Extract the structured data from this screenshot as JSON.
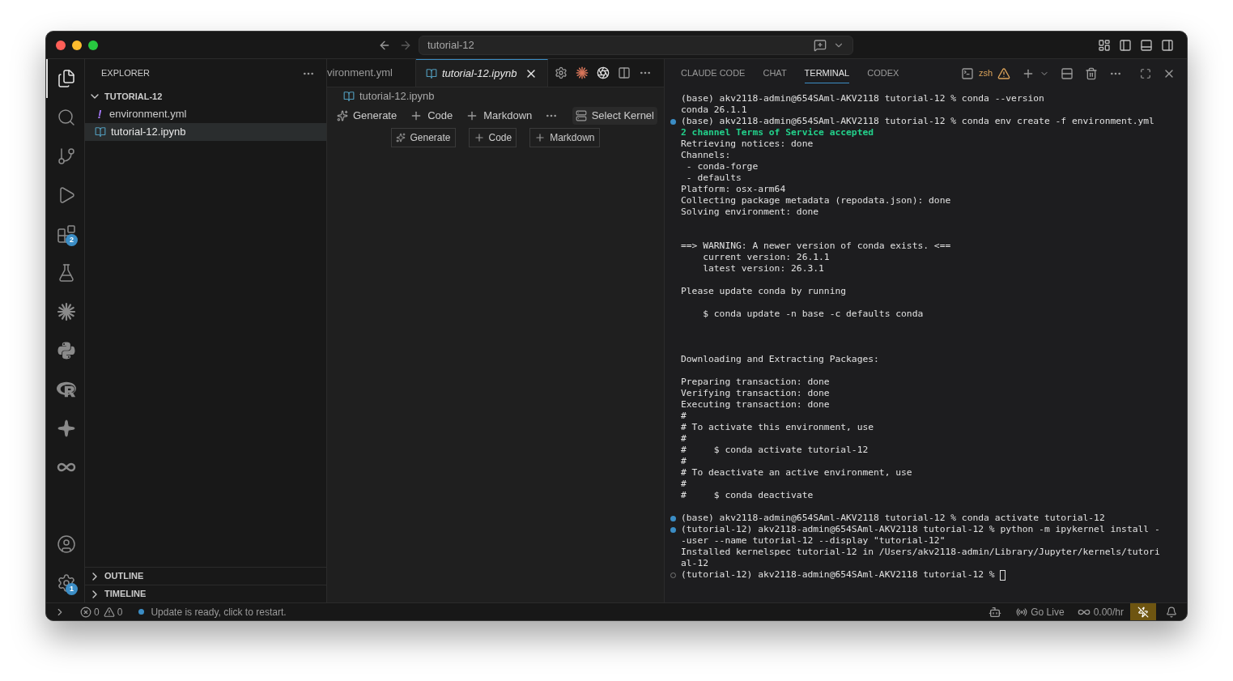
{
  "window": {
    "command_center": "tutorial-12"
  },
  "activity_bar": {
    "items": [
      {
        "kind": "explorer",
        "selected": true
      },
      {
        "kind": "search",
        "selected": false
      },
      {
        "kind": "source-control",
        "selected": false
      },
      {
        "kind": "run",
        "selected": false
      },
      {
        "kind": "extensions",
        "selected": false,
        "badge": "2"
      },
      {
        "kind": "testing",
        "selected": false
      },
      {
        "kind": "claude",
        "selected": false
      },
      {
        "kind": "python",
        "selected": false
      },
      {
        "kind": "r",
        "selected": false
      },
      {
        "kind": "sparkle",
        "selected": false
      },
      {
        "kind": "loop",
        "selected": false
      }
    ],
    "bottom": [
      {
        "kind": "account"
      },
      {
        "kind": "settings",
        "badge": "1"
      }
    ]
  },
  "sidebar": {
    "title": "EXPLORER",
    "folder": {
      "name": "TUTORIAL-12",
      "expanded": true,
      "files": [
        {
          "name": "environment.yml",
          "kind": "yaml",
          "glyph": "!",
          "selected": false
        },
        {
          "name": "tutorial-12.ipynb",
          "kind": "notebook",
          "selected": true
        }
      ]
    },
    "sections": [
      {
        "label": "OUTLINE",
        "expanded": false
      },
      {
        "label": "TIMELINE",
        "expanded": false
      }
    ]
  },
  "editor": {
    "tabs": [
      {
        "label": "vironment.yml",
        "selected": false
      },
      {
        "label": "tutorial-12.ipynb",
        "selected": true
      }
    ],
    "breadcrumb": "tutorial-12.ipynb",
    "toolbar": [
      "Generate",
      "Code",
      "Markdown"
    ],
    "kernel": "Select Kernel",
    "cell_buttons": [
      "Generate",
      "Code",
      "Markdown"
    ]
  },
  "panel": {
    "tabs": [
      {
        "label": "CLAUDE CODE",
        "selected": false
      },
      {
        "label": "CHAT",
        "selected": false
      },
      {
        "label": "TERMINAL",
        "selected": true
      },
      {
        "label": "CODEX",
        "selected": false
      }
    ],
    "shell": "zsh",
    "lines": [
      {
        "kind": "output",
        "text": "(base) akv2118-admin@654SAml-AKV2118 tutorial-12 % conda --version"
      },
      {
        "kind": "output",
        "text": "conda 26.1.1"
      },
      {
        "kind": "output",
        "command": true,
        "succeeded": true,
        "text": "(base) akv2118-admin@654SAml-AKV2118 tutorial-12 % conda env create -f environment.yml"
      },
      {
        "kind": "success",
        "text": "2 channel Terms of Service accepted"
      },
      {
        "kind": "output",
        "text": "Retrieving notices: done"
      },
      {
        "kind": "output",
        "text": "Channels:"
      },
      {
        "kind": "output",
        "text": " - conda-forge"
      },
      {
        "kind": "output",
        "text": " - defaults"
      },
      {
        "kind": "output",
        "text": "Platform: osx-arm64"
      },
      {
        "kind": "output",
        "text": "Collecting package metadata (repodata.json): done"
      },
      {
        "kind": "output",
        "text": "Solving environment: done"
      },
      {
        "kind": "blank"
      },
      {
        "kind": "blank"
      },
      {
        "kind": "output",
        "text": "==> WARNING: A newer version of conda exists. <=="
      },
      {
        "kind": "output",
        "text": "    current version: 26.1.1"
      },
      {
        "kind": "output",
        "text": "    latest version: 26.3.1"
      },
      {
        "kind": "blank"
      },
      {
        "kind": "output",
        "text": "Please update conda by running"
      },
      {
        "kind": "blank"
      },
      {
        "kind": "output",
        "text": "    $ conda update -n base -c defaults conda"
      },
      {
        "kind": "blank"
      },
      {
        "kind": "blank"
      },
      {
        "kind": "blank"
      },
      {
        "kind": "output",
        "text": "Downloading and Extracting Packages:"
      },
      {
        "kind": "blank"
      },
      {
        "kind": "output",
        "text": "Preparing transaction: done"
      },
      {
        "kind": "output",
        "text": "Verifying transaction: done"
      },
      {
        "kind": "output",
        "text": "Executing transaction: done"
      },
      {
        "kind": "output",
        "text": "#"
      },
      {
        "kind": "output",
        "text": "# To activate this environment, use"
      },
      {
        "kind": "output",
        "text": "#"
      },
      {
        "kind": "output",
        "text": "#     $ conda activate tutorial-12"
      },
      {
        "kind": "output",
        "text": "#"
      },
      {
        "kind": "output",
        "text": "# To deactivate an active environment, use"
      },
      {
        "kind": "output",
        "text": "#"
      },
      {
        "kind": "output",
        "text": "#     $ conda deactivate"
      },
      {
        "kind": "blank"
      },
      {
        "kind": "output",
        "command": true,
        "succeeded": true,
        "text": "(base) akv2118-admin@654SAml-AKV2118 tutorial-12 % conda activate tutorial-12"
      },
      {
        "kind": "output",
        "command": true,
        "succeeded": true,
        "text": "(tutorial-12) akv2118-admin@654SAml-AKV2118 tutorial-12 % python -m ipykernel install -"
      },
      {
        "kind": "output",
        "text": "-user --name tutorial-12 --display \"tutorial-12\""
      },
      {
        "kind": "output",
        "text": "Installed kernelspec tutorial-12 in /Users/akv2118-admin/Library/Jupyter/kernels/tutori"
      },
      {
        "kind": "output",
        "text": "al-12"
      },
      {
        "kind": "output",
        "command": true,
        "succeeded": false,
        "cursor": true,
        "text": "(tutorial-12) akv2118-admin@654SAml-AKV2118 tutorial-12 % "
      }
    ]
  },
  "status_bar": {
    "errors": "0",
    "warnings": "0",
    "message": "Update is ready, click to restart.",
    "go_live": "Go Live",
    "cost": "0.00/hr"
  }
}
